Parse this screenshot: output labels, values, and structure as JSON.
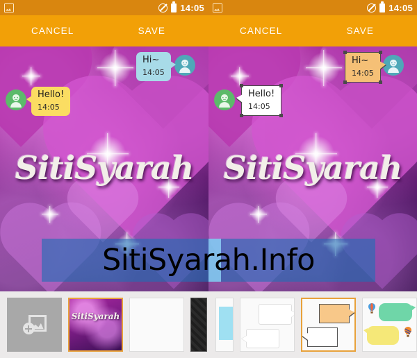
{
  "app": {
    "name": "chat-wallpaper-editor"
  },
  "statusbar": {
    "icons": [
      "gallery-icon",
      "mute-icon",
      "battery-icon"
    ],
    "time": "14:05"
  },
  "actionbar": {
    "cancel_label": "CANCEL",
    "save_label": "SAVE"
  },
  "wallpaper": {
    "name_text": "SitiSyarah"
  },
  "panels": [
    {
      "id": "left-panel",
      "bubble_style": "rounded",
      "messages": [
        {
          "id": "incoming",
          "text": "Hi~",
          "time": "14:05",
          "side": "right",
          "bubble_color": "#a8dbe8",
          "avatar_color": "#4fa8b8"
        },
        {
          "id": "outgoing",
          "text": "Hello!",
          "time": "14:05",
          "side": "left",
          "bubble_color": "#fbdd62",
          "avatar_color": "#5cba6a"
        }
      ],
      "tray": {
        "items": [
          {
            "id": "add-image",
            "type": "add",
            "label": "",
            "selected": false
          },
          {
            "id": "current-wallpaper",
            "type": "wallpaper",
            "label": "SitiSyarah",
            "selected": true
          },
          {
            "id": "plain-white",
            "type": "plain",
            "label": "",
            "selected": false
          },
          {
            "id": "dark-pattern",
            "type": "dark",
            "label": "",
            "selected": false
          }
        ]
      }
    },
    {
      "id": "right-panel",
      "bubble_style": "sketch",
      "messages": [
        {
          "id": "incoming",
          "text": "Hi~",
          "time": "14:05",
          "side": "right",
          "bubble_color": "#f5c076",
          "avatar_color": "#4fa8b8"
        },
        {
          "id": "outgoing",
          "text": "Hello!",
          "time": "14:05",
          "side": "left",
          "bubble_color": "#ffffff",
          "avatar_color": "#5cba6a"
        }
      ],
      "tray": {
        "items": [
          {
            "id": "cyan-bubble-style",
            "type": "cyan",
            "label": "",
            "selected": false
          },
          {
            "id": "plain-outline-style",
            "type": "outline",
            "label": "",
            "selected": false
          },
          {
            "id": "sketch-style",
            "type": "sketch",
            "label": "",
            "selected": true
          },
          {
            "id": "balloon-style",
            "type": "balloon",
            "label": "",
            "selected": false
          }
        ]
      }
    }
  ],
  "watermark": {
    "text": "SitiSyarah.Info"
  },
  "colors": {
    "statusbar_bg": "#d9860f",
    "actionbar_bg": "#f2a007",
    "selected_border": "#e8a13a",
    "watermark_band": "#216eb4",
    "tray_bg": "#eceaea"
  }
}
